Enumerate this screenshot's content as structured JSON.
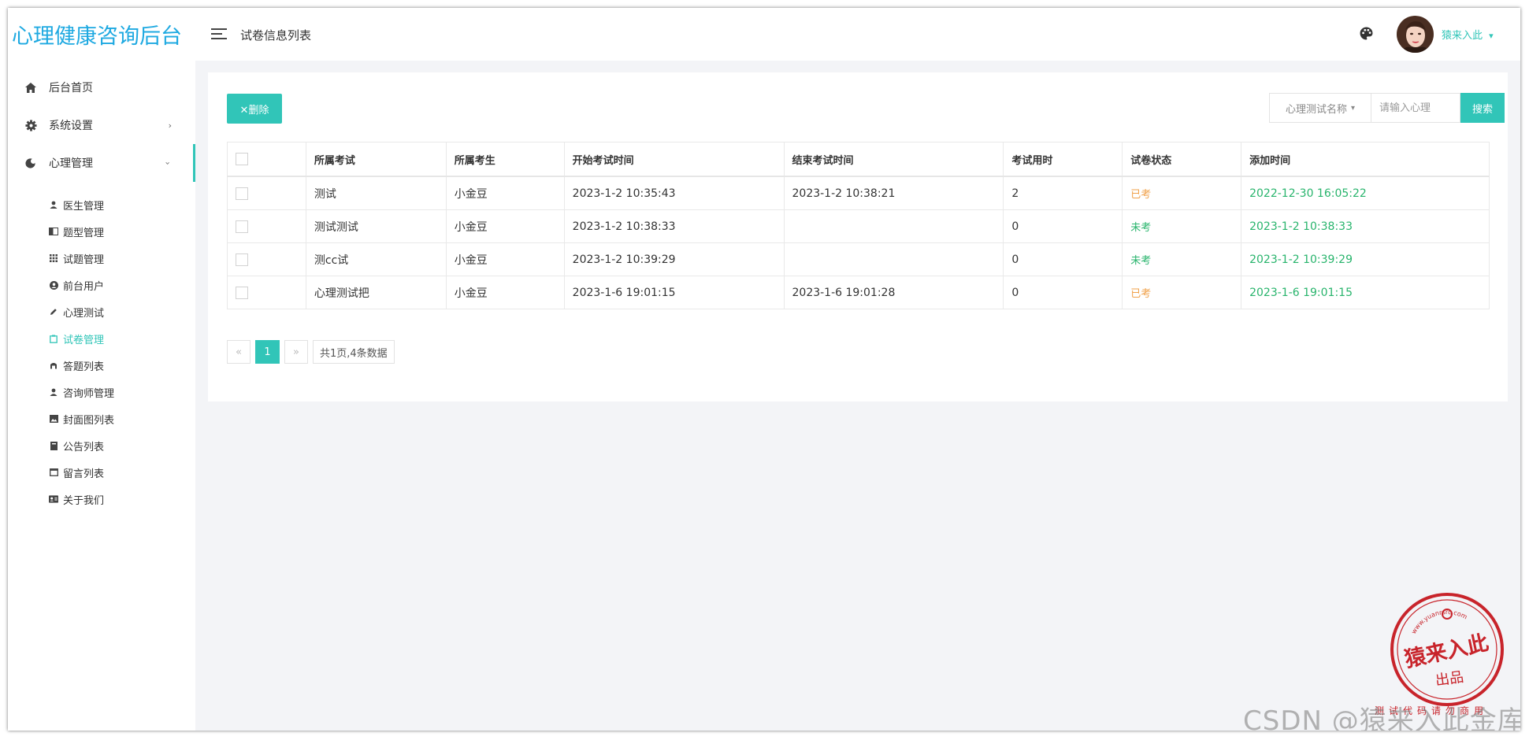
{
  "app": {
    "title": "心理健康咨询后台"
  },
  "sidebar": {
    "items": [
      {
        "label": "后台首页",
        "icon": "home-icon"
      },
      {
        "label": "系统设置",
        "icon": "gear-icon",
        "arrow": "›"
      },
      {
        "label": "心理管理",
        "icon": "globe-icon",
        "arrow": "›"
      }
    ],
    "subitems": [
      {
        "label": "医生管理",
        "icon": "user-icon"
      },
      {
        "label": "题型管理",
        "icon": "book-icon"
      },
      {
        "label": "试题管理",
        "icon": "grid-icon"
      },
      {
        "label": "前台用户",
        "icon": "user-circle-icon"
      },
      {
        "label": "心理测试",
        "icon": "pencil-icon"
      },
      {
        "label": "试卷管理",
        "icon": "clipboard-icon"
      },
      {
        "label": "答题列表",
        "icon": "puzzle-icon"
      },
      {
        "label": "咨询师管理",
        "icon": "user-icon"
      },
      {
        "label": "封面图列表",
        "icon": "image-icon"
      },
      {
        "label": "公告列表",
        "icon": "notebook-icon"
      },
      {
        "label": "留言列表",
        "icon": "window-icon"
      },
      {
        "label": "关于我们",
        "icon": "id-card-icon"
      }
    ],
    "active": "试卷管理"
  },
  "header": {
    "breadcrumb": "试卷信息列表",
    "username": "猿来入此",
    "username_caret": "▾"
  },
  "toolbar": {
    "delete_label": "✕删除",
    "search_type": "心理测试名称",
    "search_type_caret": "▾",
    "search_placeholder": "请输入心理",
    "search_label": "搜索"
  },
  "table": {
    "columns": [
      "所属考试",
      "所属考生",
      "开始考试时间",
      "结束考试时间",
      "考试用时",
      "试卷状态",
      "添加时间"
    ],
    "rows": [
      {
        "exam": "测试",
        "student": "小金豆",
        "start": "2023-1-2 10:35:43",
        "end": "2023-1-2 10:38:21",
        "duration": "2",
        "status": "已考",
        "added": "2022-12-30 16:05:22"
      },
      {
        "exam": "测试测试",
        "student": "小金豆",
        "start": "2023-1-2 10:38:33",
        "end": "",
        "duration": "0",
        "status": "未考",
        "added": "2023-1-2 10:38:33"
      },
      {
        "exam": "测cc试",
        "student": "小金豆",
        "start": "2023-1-2 10:39:29",
        "end": "",
        "duration": "0",
        "status": "未考",
        "added": "2023-1-2 10:39:29"
      },
      {
        "exam": "心理测试把",
        "student": "小金豆",
        "start": "2023-1-6 19:01:15",
        "end": "2023-1-6 19:01:28",
        "duration": "0",
        "status": "已考",
        "added": "2023-1-6 19:01:15"
      }
    ]
  },
  "pagination": {
    "prev": "«",
    "current": "1",
    "next": "»",
    "info": "共1页,4条数据"
  },
  "watermark": {
    "csdn": "CSDN @猿来入此金库",
    "stamp_main": "猿来入此",
    "stamp_sub": "出品",
    "stamp_url": "www.yuanrsrc.com",
    "stamp_bottom": "测试代码请勿商用"
  },
  "colors": {
    "accent": "#31c5b8",
    "logo": "#1ea9e1",
    "done": "#f0a14a",
    "not_done": "#28b46c",
    "stamp": "#c8242b"
  }
}
